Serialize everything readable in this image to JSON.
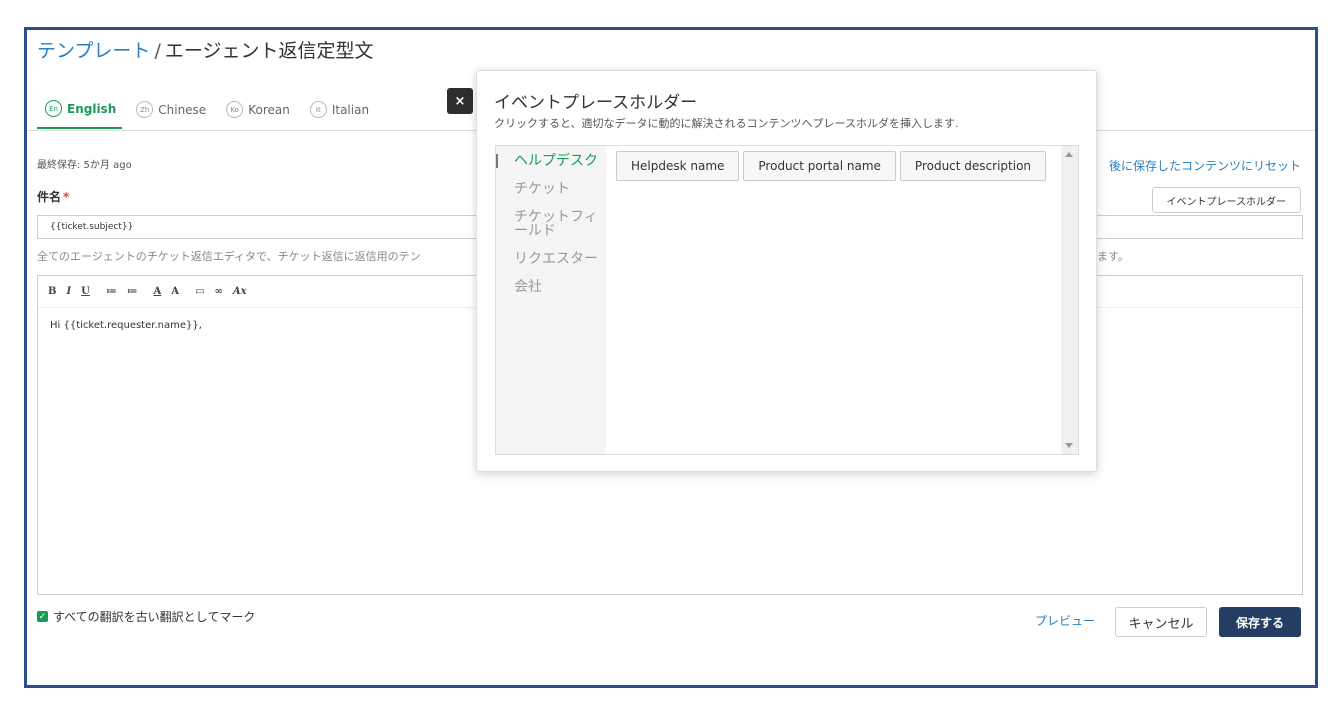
{
  "page": {
    "title_crumb": "テンプレート",
    "title_separator": "/",
    "title_current": "エージェント返信定型文"
  },
  "languages": [
    {
      "code": "En",
      "label": "English",
      "active": true
    },
    {
      "code": "Zh",
      "label": "Chinese",
      "active": false
    },
    {
      "code": "Ko",
      "label": "Korean",
      "active": false
    },
    {
      "code": "It",
      "label": "Italian",
      "active": false
    }
  ],
  "form": {
    "last_saved": "最終保存: 5か月 ago",
    "reset_link": "後に保存したコンテンツにリセット",
    "subject_label": "件名",
    "required_mark": "*",
    "event_placeholder_button": "イベントプレースホルダー",
    "subject_value": "{{ticket.subject}}",
    "helper_text": "全てのエージェントのチケット返信エディタで、チケット返信に返信用のテン",
    "helper_text_tail": "ます。",
    "editor_body": "Hi {{ticket.requester.name}},"
  },
  "toolbar": {
    "bold": "B",
    "italic": "I",
    "underline": "U",
    "bullet_list": "≔",
    "number_list": "≔",
    "font_color": "A",
    "bg_color": "A",
    "image": "▭",
    "link": "∞",
    "clear_format": "Ax"
  },
  "footer": {
    "mark_all_checked": true,
    "mark_all_label": "すべての翻訳を古い翻訳としてマーク",
    "preview": "プレビュー",
    "cancel": "キャンセル",
    "save": "保存する"
  },
  "popover": {
    "close": "×",
    "title": "イベントプレースホルダー",
    "subtitle": "クリックすると、適切なデータに動的に解決されるコンテンツへプレースホルダを挿入します.",
    "categories": [
      "ヘルプデスク",
      "チケット",
      "チケットフィールド",
      "リクエスター",
      "会社"
    ],
    "active_category": 0,
    "placeholders": [
      "Helpdesk name",
      "Product portal name",
      "Product description"
    ]
  },
  "colors": {
    "accent_green": "#1b9a55",
    "link_blue": "#2a7fc1",
    "save_button_bg": "#243e63",
    "frame_border": "#2d4e8a"
  }
}
